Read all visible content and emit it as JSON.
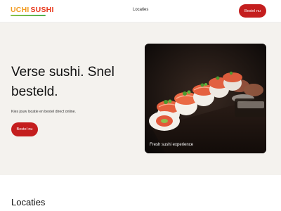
{
  "header": {
    "logo_word1": "UCHI",
    "logo_word2": "SUSHI",
    "nav_link": "Locaties",
    "cta_label": "Bestel nu"
  },
  "hero": {
    "title": "Verse sushi. Snel besteld.",
    "subtitle": "Kies jouw locatie en bestel direct online.",
    "cta_label": "Bestel nu",
    "image_caption": "Fresh sushi experience"
  },
  "section": {
    "title": "Locaties"
  },
  "colors": {
    "brand_red": "#c41e1e",
    "logo_orange": "#f29a1f",
    "logo_red": "#e8391d",
    "logo_green": "#8bc34a",
    "hero_bg": "#f4f2ee"
  }
}
